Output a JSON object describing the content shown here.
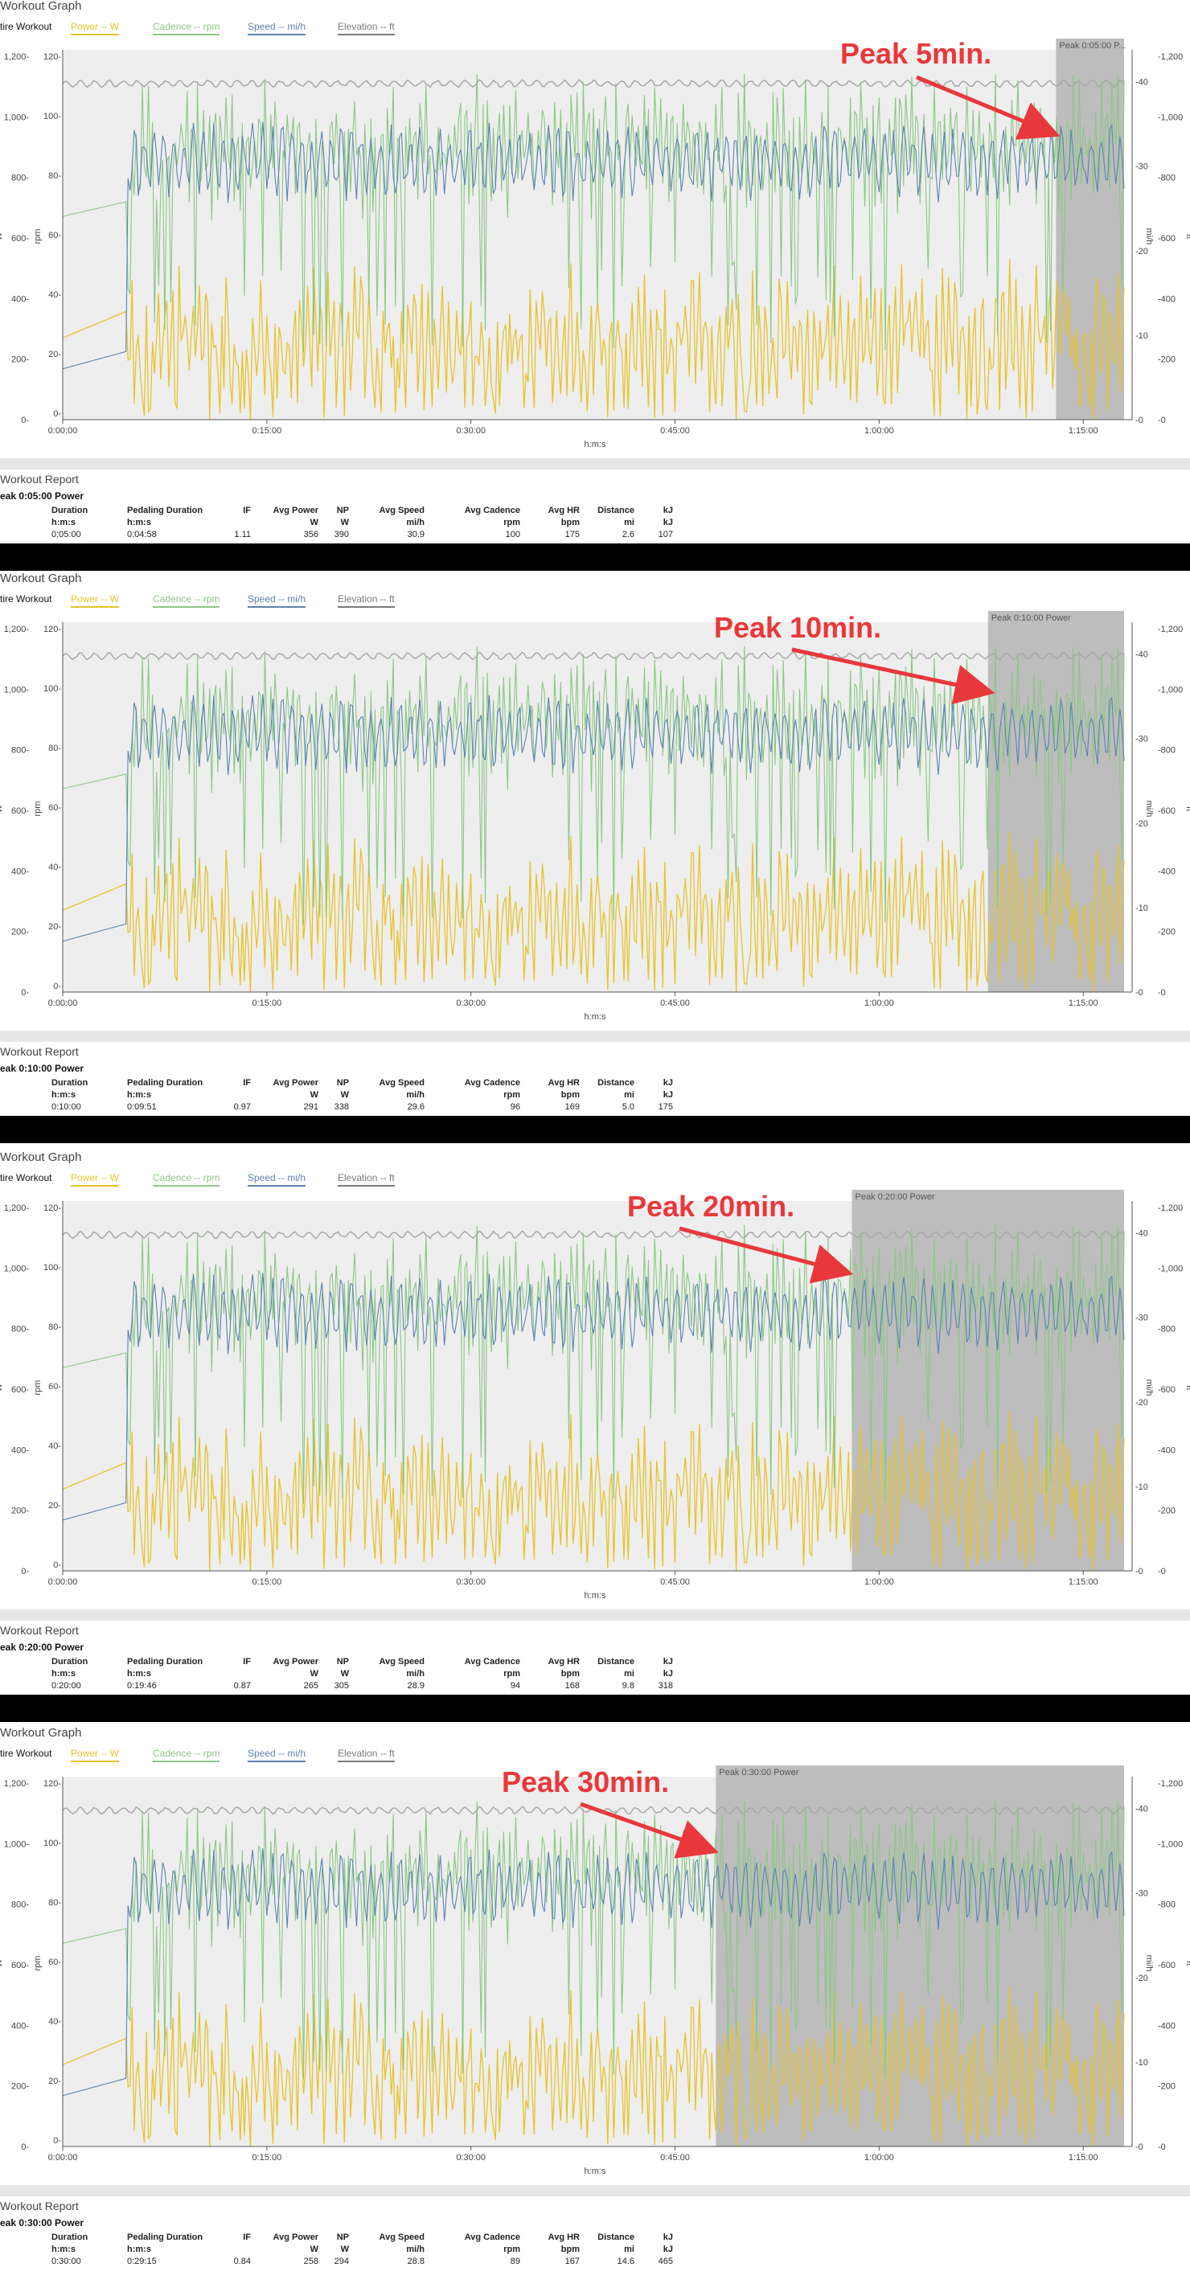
{
  "section_title": "Workout Graph",
  "entire_workout_label": "tire Workout",
  "legend": [
    {
      "label": "Power  -- W",
      "color": "#e7c32b"
    },
    {
      "label": "Cadence  -- rpm",
      "color": "#8cc784"
    },
    {
      "label": "Speed  -- mi/h",
      "color": "#5c83b0"
    },
    {
      "label": "Elevation  -- ft",
      "color": "#7a7a7a"
    }
  ],
  "report_title": "Workout Report",
  "report_headers_top": [
    "Duration",
    "Pedaling Duration",
    "IF",
    "Avg Power",
    "NP",
    "Avg Speed",
    "Avg Cadence",
    "Avg HR",
    "Distance",
    "kJ"
  ],
  "report_headers_bottom": [
    "h:m:s",
    "h:m:s",
    "",
    "W",
    "W",
    "mi/h",
    "rpm",
    "bpm",
    "mi",
    "kJ"
  ],
  "panels": [
    {
      "annotation": "Peak 5min.",
      "peak_label": "Peak 0:05:00 P...",
      "report_subtitle": "eak 0:05:00 Power",
      "report_values": [
        "0:05:00",
        "0:04:58",
        "1.11",
        "356",
        "390",
        "30.9",
        "100",
        "175",
        "2.6",
        "107"
      ]
    },
    {
      "annotation": "Peak 10min.",
      "peak_label": "Peak 0:10:00 Power",
      "report_subtitle": "eak 0:10:00 Power",
      "report_values": [
        "0:10:00",
        "0:09:51",
        "0.97",
        "291",
        "338",
        "29.6",
        "96",
        "169",
        "5.0",
        "175"
      ]
    },
    {
      "annotation": "Peak 20min.",
      "peak_label": "Peak 0:20:00 Power",
      "report_subtitle": "eak 0:20:00 Power",
      "report_values": [
        "0:20:00",
        "0:19:46",
        "0.87",
        "265",
        "305",
        "28.9",
        "94",
        "168",
        "9.8",
        "318"
      ]
    },
    {
      "annotation": "Peak 30min.",
      "peak_label": "Peak 0:30:00 Power",
      "report_subtitle": "eak 0:30:00 Power",
      "report_values": [
        "0:30:00",
        "0:29:15",
        "0.84",
        "258",
        "294",
        "28.8",
        "89",
        "167",
        "14.6",
        "465"
      ]
    }
  ],
  "chart_data": [
    {
      "type": "line",
      "x_ticks": [
        "0:00:00",
        "0:15:00",
        "0:30:00",
        "0:45:00",
        "1:00:00",
        "1:15:00"
      ],
      "x_label": "h:m:s",
      "y_axes": {
        "power": {
          "unit": "W",
          "ticks": [
            "0",
            "200",
            "400",
            "600",
            "800",
            "1,000",
            "1,200"
          ]
        },
        "cadence": {
          "unit": "rpm",
          "ticks": [
            "0",
            "20",
            "40",
            "60",
            "80",
            "100",
            "120"
          ]
        },
        "speed": {
          "unit": "mi/h",
          "ticks": [
            "0",
            "10",
            "20",
            "30",
            "40"
          ]
        },
        "elevation": {
          "unit": "ft",
          "ticks": [
            "0",
            "200",
            "400",
            "600",
            "800",
            "1,000",
            "1,200"
          ]
        }
      },
      "highlight_range_min": [
        73.0,
        78.0
      ],
      "series": [
        {
          "name": "Power",
          "color": "#e7c32b"
        },
        {
          "name": "Cadence",
          "color": "#8cc784"
        },
        {
          "name": "Speed",
          "color": "#5c83b0"
        },
        {
          "name": "Elevation",
          "color": "#9a9a9a"
        }
      ]
    },
    {
      "type": "line",
      "x_ticks": [
        "0:00:00",
        "0:15:00",
        "0:30:00",
        "0:45:00",
        "1:00:00",
        "1:15:00"
      ],
      "x_label": "h:m:s",
      "highlight_range_min": [
        68.0,
        78.0
      ]
    },
    {
      "type": "line",
      "x_ticks": [
        "0:00:00",
        "0:15:00",
        "0:30:00",
        "0:45:00",
        "1:00:00",
        "1:15:00"
      ],
      "x_label": "h:m:s",
      "highlight_range_min": [
        58.0,
        78.0
      ]
    },
    {
      "type": "line",
      "x_ticks": [
        "0:00:00",
        "0:15:00",
        "0:30:00",
        "0:45:00",
        "1:00:00",
        "1:15:00"
      ],
      "x_label": "h:m:s",
      "highlight_range_min": [
        48.0,
        78.0
      ]
    }
  ]
}
